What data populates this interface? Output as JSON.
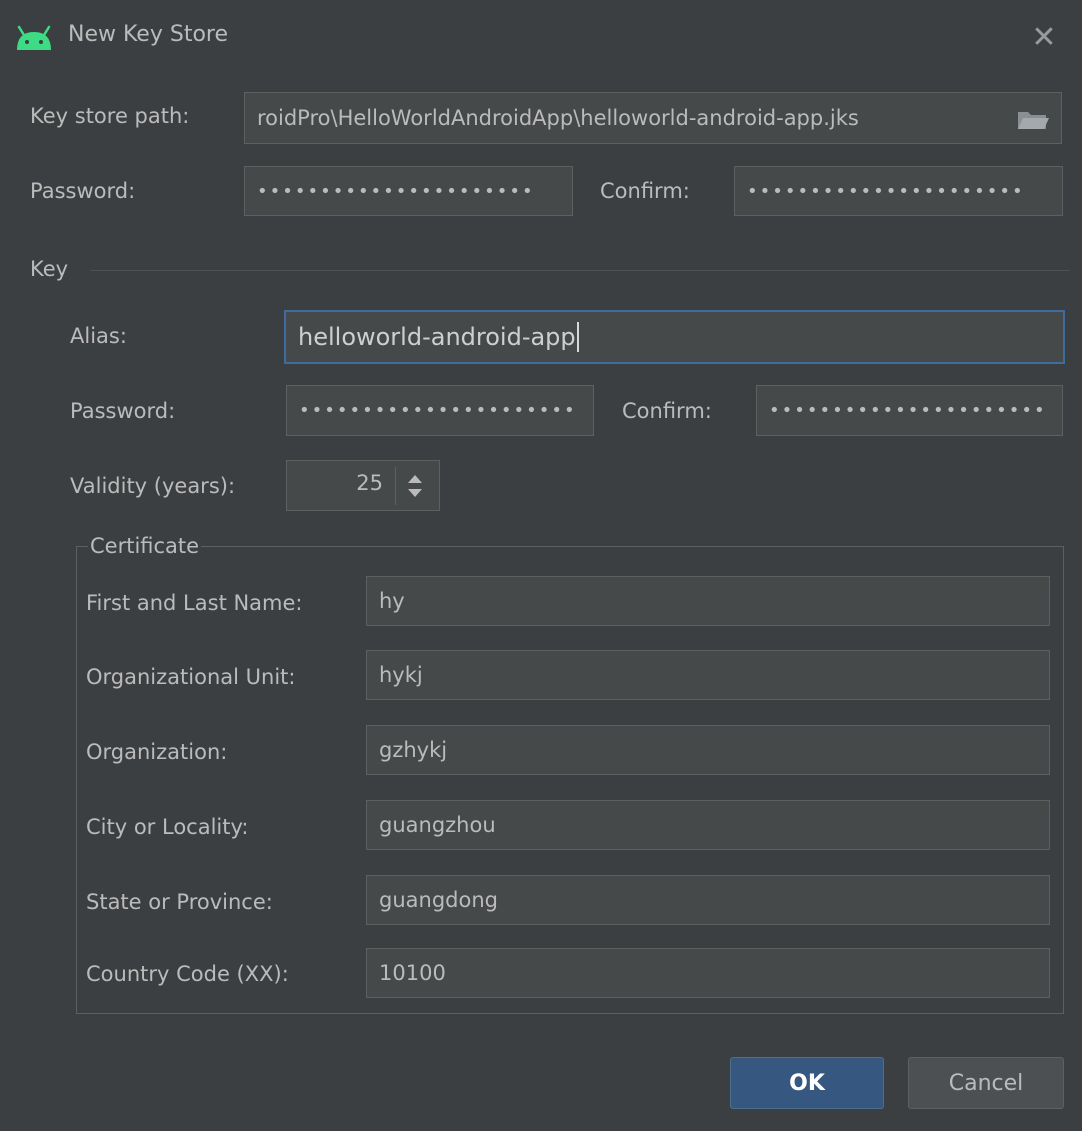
{
  "window": {
    "title": "New Key Store"
  },
  "keystore": {
    "path_label": "Key store path:",
    "path_value": "roidPro\\HelloWorldAndroidApp\\helloworld-android-app.jks",
    "password_label": "Password:",
    "password_value": "••••••••••••••••••••••",
    "confirm_label": "Confirm:",
    "confirm_value": "••••••••••••••••••••••"
  },
  "key": {
    "section_title": "Key",
    "alias_label": "Alias:",
    "alias_value": "helloworld-android-app",
    "password_label": "Password:",
    "password_value": "••••••••••••••••••••••",
    "confirm_label": "Confirm:",
    "confirm_value": "••••••••••••••••••••••",
    "validity_label": "Validity (years):",
    "validity_value": "25"
  },
  "certificate": {
    "title": "Certificate",
    "fields": [
      {
        "label": "First and Last Name:",
        "value": "hy"
      },
      {
        "label": "Organizational Unit:",
        "value": "hykj"
      },
      {
        "label": "Organization:",
        "value": "gzhykj"
      },
      {
        "label": "City or Locality:",
        "value": "guangzhou"
      },
      {
        "label": "State or Province:",
        "value": "guangdong"
      },
      {
        "label": "Country Code (XX):",
        "value": "10100"
      }
    ]
  },
  "buttons": {
    "ok": "OK",
    "cancel": "Cancel"
  },
  "icons": {
    "app": "android-icon",
    "close": "close-icon",
    "folder": "folder-icon",
    "spinner": "spinner-arrows-icon"
  },
  "colors": {
    "background": "#3c3f41",
    "field": "#45494a",
    "focus_border": "#3d6c9e",
    "ok_button": "#365880",
    "android_green": "#3ddc84"
  }
}
